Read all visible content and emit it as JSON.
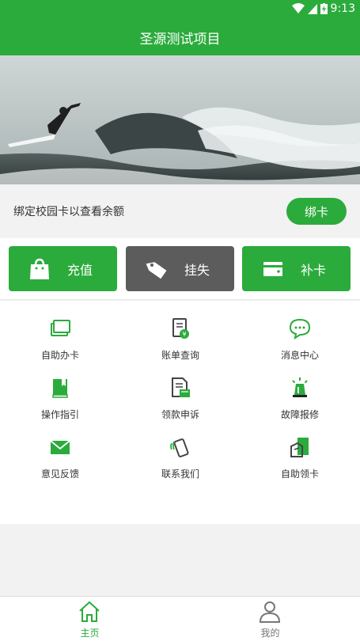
{
  "status": {
    "time": "9:13"
  },
  "app": {
    "title": "圣源测试项目"
  },
  "bind": {
    "prompt": "绑定校园卡以查看余额",
    "button": "绑卡"
  },
  "actions": [
    {
      "label": "充值",
      "icon": "shopping-bag-icon",
      "color": "#2bab3c"
    },
    {
      "label": "挂失",
      "icon": "tag-icon",
      "color": "#5c5c5c"
    },
    {
      "label": "补卡",
      "icon": "card-icon",
      "color": "#2bab3c"
    }
  ],
  "grid": [
    {
      "label": "自助办卡",
      "icon": "card-stack-icon"
    },
    {
      "label": "账单查询",
      "icon": "bill-icon"
    },
    {
      "label": "消息中心",
      "icon": "chat-icon"
    },
    {
      "label": "操作指引",
      "icon": "book-icon"
    },
    {
      "label": "领款申诉",
      "icon": "document-icon"
    },
    {
      "label": "故障报修",
      "icon": "alarm-light-icon"
    },
    {
      "label": "意见反馈",
      "icon": "envelope-icon"
    },
    {
      "label": "联系我们",
      "icon": "phone-icon"
    },
    {
      "label": "自助领卡",
      "icon": "card-receive-icon"
    }
  ],
  "tabs": [
    {
      "label": "主页",
      "icon": "home-icon",
      "active": true
    },
    {
      "label": "我的",
      "icon": "user-icon",
      "active": false
    }
  ],
  "colors": {
    "accent": "#2bab3c",
    "inactive_tab": "#777777"
  }
}
